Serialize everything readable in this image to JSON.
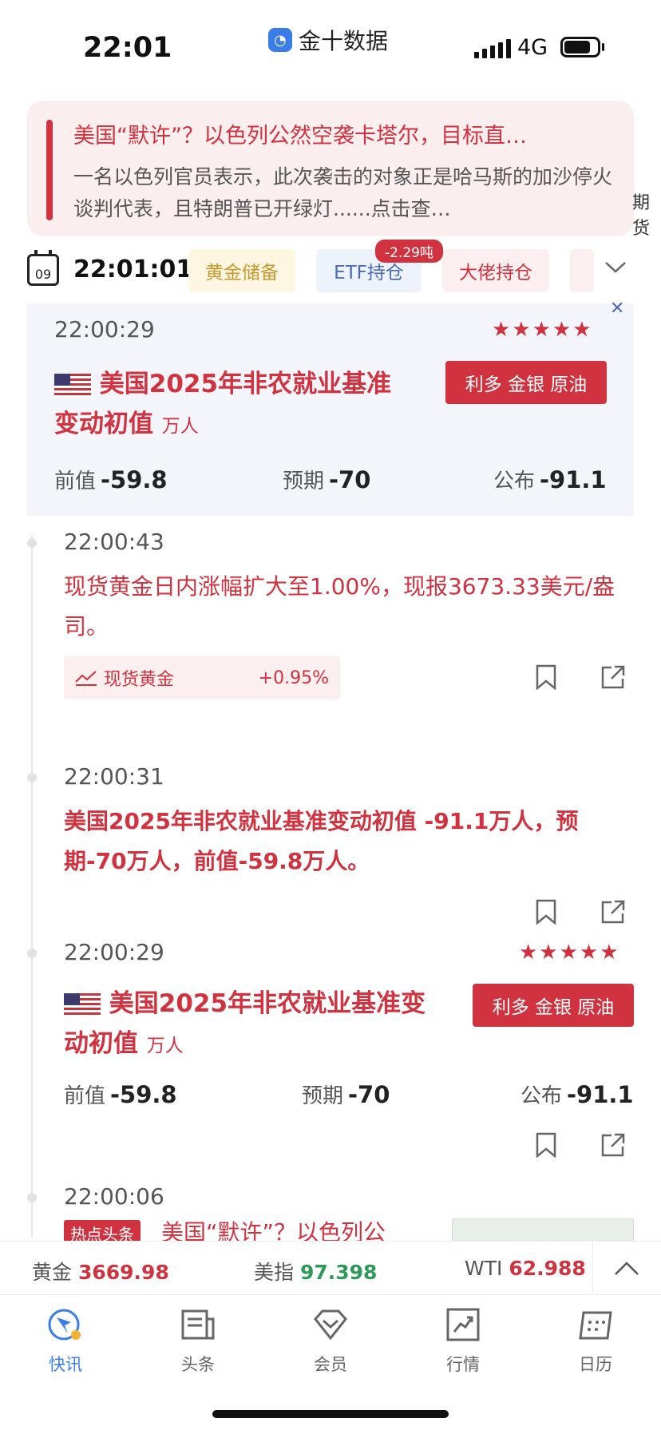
{
  "status_bar": {
    "time": "22:01",
    "app_name": "金十数据",
    "network": "4G"
  },
  "banner": {
    "title": "美国“默许”？以色列公然空袭卡塔尔，目标直…",
    "body": "一名以色列官员表示，此次袭击的对象正是哈马斯的加沙停火谈判代表，且特朗普已开绿灯......点击查…",
    "side_snippet": "期货"
  },
  "filter_bar": {
    "calendar_day": "09",
    "current_time": "22:01:01",
    "chips": [
      "黄金储备",
      "ETF持仓",
      "大佬持仓"
    ],
    "etf_badge": "-2.29吨"
  },
  "pinned_card": {
    "time": "22:00:29",
    "stars": "★★★★★",
    "title": "美国2025年非农就业基准变动初值",
    "unit": "万人",
    "tag": "利多 金银 原油",
    "prev_label": "前值",
    "prev_value": "-59.8",
    "exp_label": "预期",
    "exp_value": "-70",
    "actual_label": "公布",
    "actual_value": "-91.1"
  },
  "feed": [
    {
      "time": "22:00:43",
      "text": "现货黄金日内涨幅扩大至1.00%，现报3673.33美元/盎司。",
      "chip_label": "现货黄金",
      "chip_value": "+0.95%"
    },
    {
      "time": "22:00:31",
      "text": "美国2025年非农就业基准变动初值 -91.1万人，预期-70万人，前值-59.8万人。"
    },
    {
      "time": "22:00:29",
      "stars": "★★★★★",
      "title": "美国2025年非农就业基准变动初值",
      "unit": "万人",
      "tag": "利多 金银 原油",
      "prev_label": "前值",
      "prev_value": "-59.8",
      "exp_label": "预期",
      "exp_value": "-70",
      "actual_label": "公布",
      "actual_value": "-91.1"
    },
    {
      "time": "22:00:06",
      "hot_tag": "热点头条",
      "title": "美国“默许”？以色列公"
    }
  ],
  "ticker": [
    {
      "label": "黄金",
      "value": "3669.98",
      "trend": "up"
    },
    {
      "label": "美指",
      "value": "97.398",
      "trend": "down"
    },
    {
      "label": "WTI",
      "value": "62.988",
      "trend": "up"
    }
  ],
  "tabs": [
    {
      "label": "快讯",
      "icon": "flash-news-icon",
      "active": true
    },
    {
      "label": "头条",
      "icon": "headlines-icon",
      "active": false
    },
    {
      "label": "会员",
      "icon": "vip-diamond-icon",
      "active": false
    },
    {
      "label": "行情",
      "icon": "market-chart-icon",
      "active": false
    },
    {
      "label": "日历",
      "icon": "calendar-icon",
      "active": false
    }
  ],
  "colors": {
    "accent_red": "#d0323f",
    "accent_blue": "#3b7de8",
    "up": "#d0323f",
    "down": "#2e9a5a"
  }
}
